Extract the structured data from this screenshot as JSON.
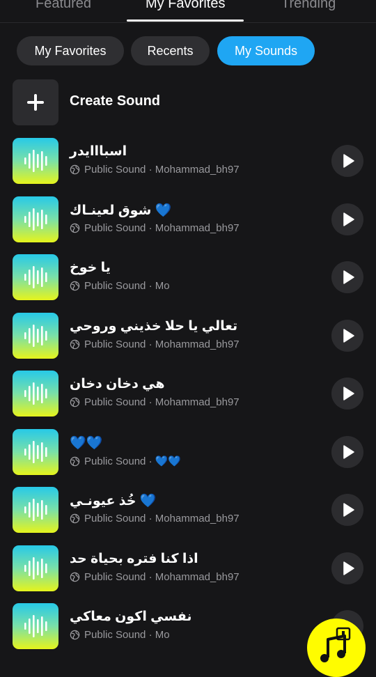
{
  "top_tabs": [
    {
      "label": "Featured"
    },
    {
      "label": "My Favorites"
    },
    {
      "label": "Trending"
    }
  ],
  "chips": [
    {
      "label": "My Favorites"
    },
    {
      "label": "Recents"
    },
    {
      "label": "My Sounds"
    }
  ],
  "create": {
    "label": "Create Sound"
  },
  "sounds": [
    {
      "title": "اسبااايدر",
      "subtitle": "Public Sound · Mohammad_bh97"
    },
    {
      "title": "شوق لعينـاك 💙",
      "subtitle": "Public Sound · Mohammad_bh97"
    },
    {
      "title": "يا خوخ",
      "subtitle": "Public Sound · Mo"
    },
    {
      "title": "تعالي يا حلا خذيني وروحي",
      "subtitle": "Public Sound · Mohammad_bh97"
    },
    {
      "title": "هي دخان دخان",
      "subtitle": "Public Sound · Mohammad_bh97"
    },
    {
      "title": "💙💙",
      "subtitle": "Public Sound · 💙💙"
    },
    {
      "title": "خُذ عيونـي 💙",
      "subtitle": "Public Sound · Mohammad_bh97"
    },
    {
      "title": "اذا كنا فتره بحياة حد",
      "subtitle": "Public Sound · Mohammad_bh97"
    },
    {
      "title": "نفسي اكون معاكي",
      "subtitle": "Public Sound · Mo"
    }
  ],
  "colors": {
    "accent_blue": "#1fa6f3",
    "fab_yellow": "#fffc00",
    "background": "#161618"
  },
  "icons": {
    "create": "plus-icon",
    "thumb": "waveform-icon",
    "subtitle": "globe-icon",
    "row_action": "play-icon",
    "fab": "music-note-icon"
  }
}
